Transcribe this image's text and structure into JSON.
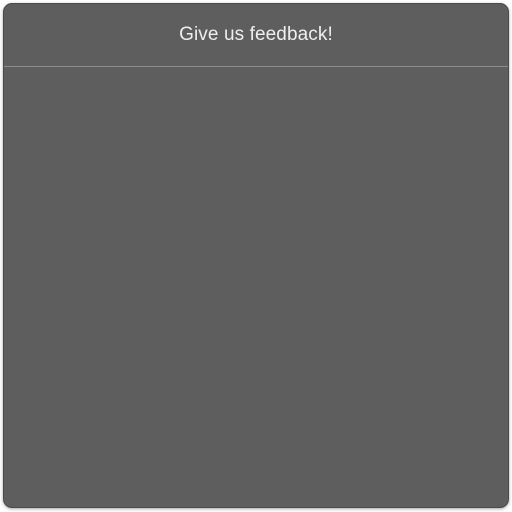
{
  "feedback_dialog": {
    "title": "Give us feedback!"
  }
}
